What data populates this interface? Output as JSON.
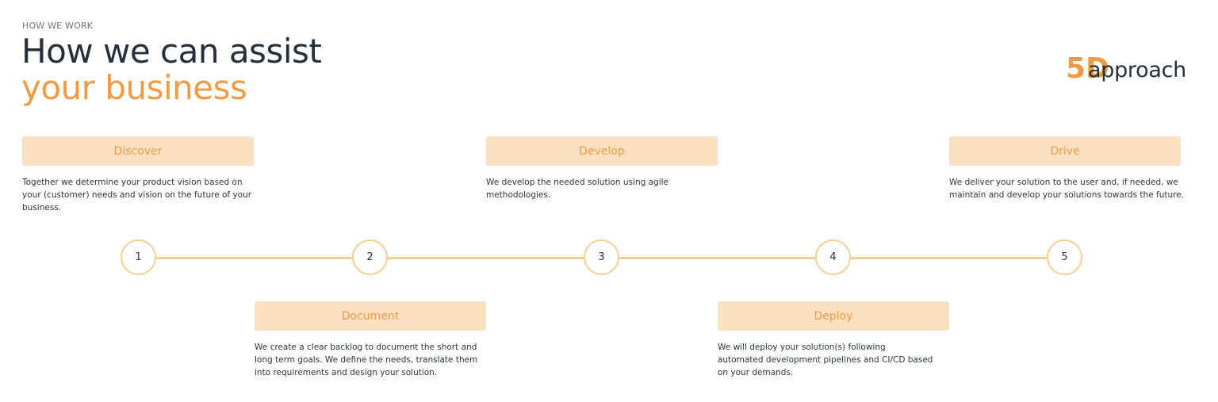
{
  "header": {
    "eyebrow": "HOW WE WORK",
    "title_line1": "How we can assist",
    "title_line2": "your business"
  },
  "logo": {
    "number": "5D",
    "word": "approach"
  },
  "steps": [
    {
      "number": "1",
      "title": "Discover",
      "description": "Together we determine your product vision based on your (customer) needs and vision on the future of your business."
    },
    {
      "number": "2",
      "title": "Document",
      "description": "We create a clear backlog to document the short and long term goals. We define the needs, translate them into requirements and design your solution."
    },
    {
      "number": "3",
      "title": "Develop",
      "description": "We develop the needed solution using agile methodologies."
    },
    {
      "number": "4",
      "title": "Deploy",
      "description": "We will deploy your solution(s) following automated development pipelines and CI/CD based on your demands."
    },
    {
      "number": "5",
      "title": "Drive",
      "description": "We deliver your solution to the user and, if needed, we maintain and develop your solutions towards the future."
    }
  ],
  "colors": {
    "accent": "#ef9a45",
    "tag_bg": "#f9e0c1",
    "line": "#f7cf98",
    "heading": "#25303d"
  }
}
